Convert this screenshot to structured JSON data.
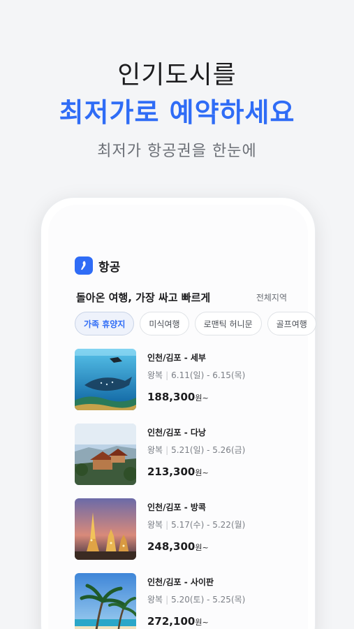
{
  "promo": {
    "line1": "인기도시를",
    "line2": "최저가로 예약하세요",
    "line3": "최저가 항공권을 한눈에"
  },
  "app": {
    "title": "항공",
    "accent": "#2f6cf6"
  },
  "section": {
    "title": "돌아온 여행, 가장 싸고 빠르게",
    "more": "전체지역"
  },
  "chips": [
    {
      "label": "가족 휴양지",
      "active": true
    },
    {
      "label": "미식여행",
      "active": false
    },
    {
      "label": "로맨틱 허니문",
      "active": false
    },
    {
      "label": "골프여행",
      "active": false
    }
  ],
  "flights": [
    {
      "route": "인천/김포 - 세부",
      "trip": "왕복",
      "dates": "6.11(일) - 6.15(목)",
      "price": "188,300",
      "unit": "원~"
    },
    {
      "route": "인천/김포 - 다낭",
      "trip": "왕복",
      "dates": "5.21(일) - 5.26(금)",
      "price": "213,300",
      "unit": "원~"
    },
    {
      "route": "인천/김포 - 방콕",
      "trip": "왕복",
      "dates": "5.17(수) - 5.22(월)",
      "price": "248,300",
      "unit": "원~"
    },
    {
      "route": "인천/김포 - 사이판",
      "trip": "왕복",
      "dates": "5.20(토) - 5.25(목)",
      "price": "272,100",
      "unit": "원~"
    }
  ]
}
